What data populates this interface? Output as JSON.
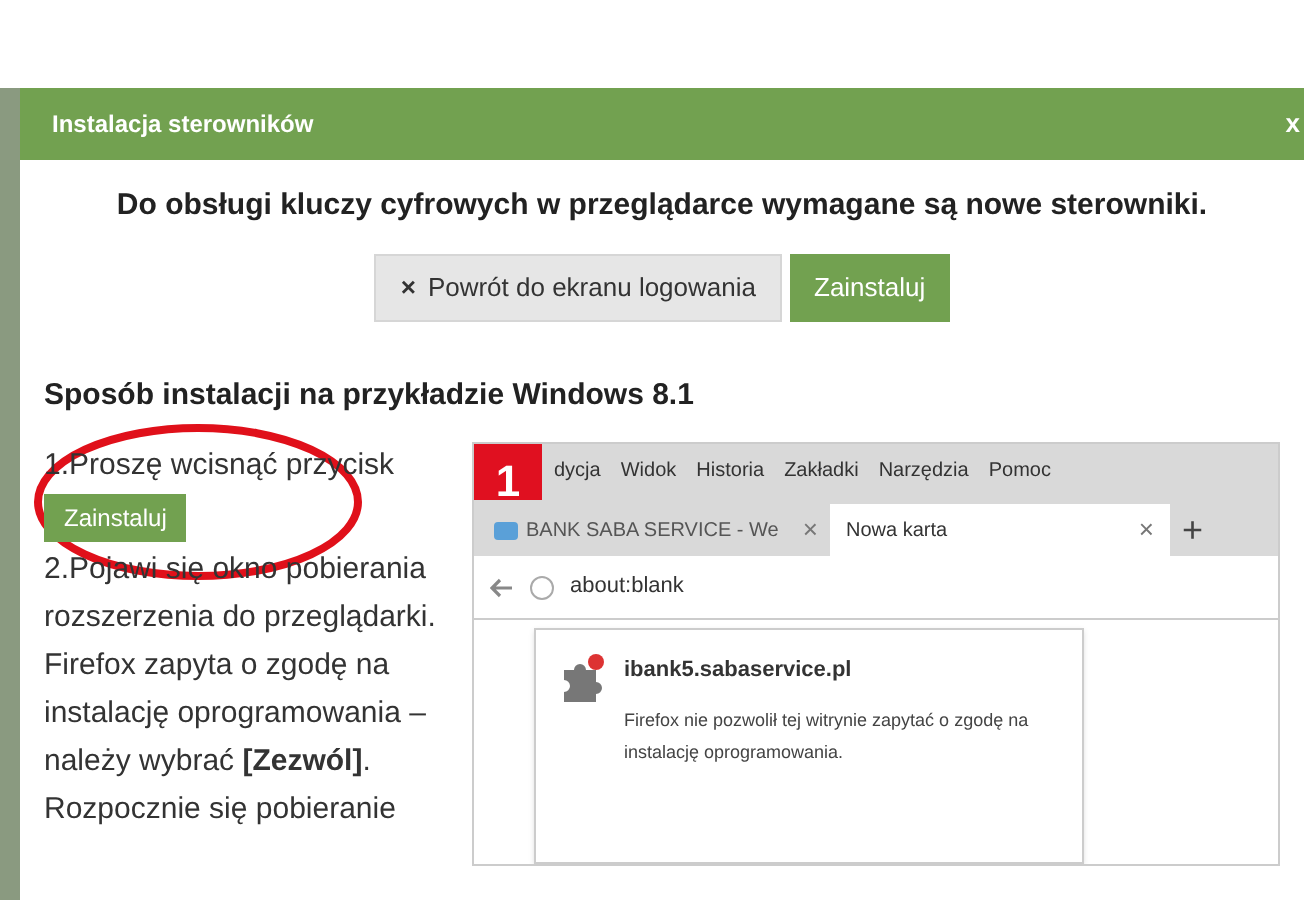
{
  "dialog": {
    "title": "Instalacja sterowników",
    "close": "x"
  },
  "message": "Do obsługi kluczy cyfrowych w przeglądarce wymagane są nowe sterowniki.",
  "buttons": [
    {
      "label": "Powrót do ekranu logowania",
      "icon": "×",
      "kind": "secondary"
    },
    {
      "label": "Zainstaluj",
      "kind": "primary"
    }
  ],
  "section_title": "Sposób instalacji na przykładzie Windows 8.1",
  "steps": [
    {
      "text": "1.Proszę wcisnąć przycisk",
      "button": "Zainstaluj"
    },
    {
      "text": "2.Pojawi się okno pobierania rozszerzenia do przeglądarki. Firefox zapyta o zgodę na instalację oprogramowania – należy wybrać **[Zezwól]**. Rozpocznie się pobieranie"
    }
  ],
  "example_screenshot": {
    "step_number": "1",
    "menu": [
      "dycja",
      "Widok",
      "Historia",
      "Zakładki",
      "Narzędzia",
      "Pomoc"
    ],
    "tabs": [
      {
        "label": "BANK SABA SERVICE - We",
        "close": "×",
        "selected": false
      },
      {
        "label": "Nowa karta",
        "close": "×",
        "selected": true
      }
    ],
    "new_tab": "+",
    "address": "about:blank",
    "popup": {
      "site": "ibank5.sabaservice.pl",
      "message": "Firefox nie pozwolił tej witrynie zapytać o zgodę na instalację oprogramowania."
    }
  }
}
